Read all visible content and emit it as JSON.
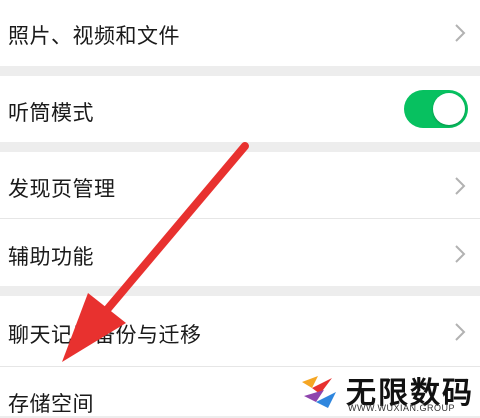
{
  "settings": {
    "items": [
      {
        "label": "照片、视频和文件"
      },
      {
        "label": "听筒模式",
        "toggle_on": true
      },
      {
        "label": "发现页管理"
      },
      {
        "label": "辅助功能"
      },
      {
        "label": "聊天记录备份与迁移"
      },
      {
        "label": "存储空间"
      }
    ]
  },
  "colors": {
    "toggle_on": "#07c160",
    "background": "#ededed",
    "arrow": "#e8312f"
  },
  "watermark": {
    "title": "无限数码",
    "subtitle": "WWW.WUXIAN.GROUP"
  }
}
